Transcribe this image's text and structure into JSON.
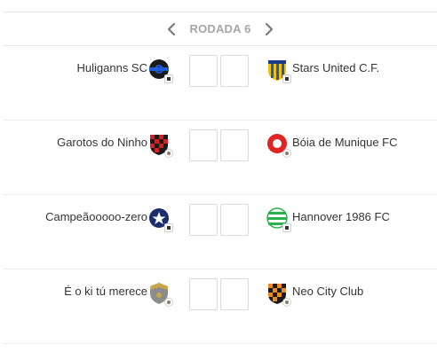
{
  "round": {
    "label": "RODADA 6",
    "prev_icon": "chevron-left-icon",
    "next_icon": "chevron-right-icon"
  },
  "matches": [
    {
      "home": {
        "name": "Huliganns SC",
        "crest": "black-blue-crest-icon"
      },
      "away": {
        "name": "Stars United C.F.",
        "crest": "yellow-blue-striped-crest-icon"
      },
      "home_score": "",
      "away_score": ""
    },
    {
      "home": {
        "name": "Garotos do Ninho",
        "crest": "red-black-checkered-crest-icon"
      },
      "away": {
        "name": "Bóia de Munique FC",
        "crest": "red-white-crest-icon"
      },
      "home_score": "",
      "away_score": ""
    },
    {
      "home": {
        "name": "Campeãooooo-zero",
        "crest": "navy-star-crest-icon"
      },
      "away": {
        "name": "Hannover 1986 FC",
        "crest": "green-white-hooped-crest-icon"
      },
      "home_score": "",
      "away_score": ""
    },
    {
      "home": {
        "name": "É o ki tú merece",
        "crest": "gray-gold-shield-crest-icon"
      },
      "away": {
        "name": "Neo City Club",
        "crest": "orange-black-checkered-crest-icon"
      },
      "home_score": "",
      "away_score": ""
    }
  ],
  "colors": {
    "round_label": "#a6a6a6",
    "text": "#333333",
    "divider": "#e6e6e6"
  }
}
